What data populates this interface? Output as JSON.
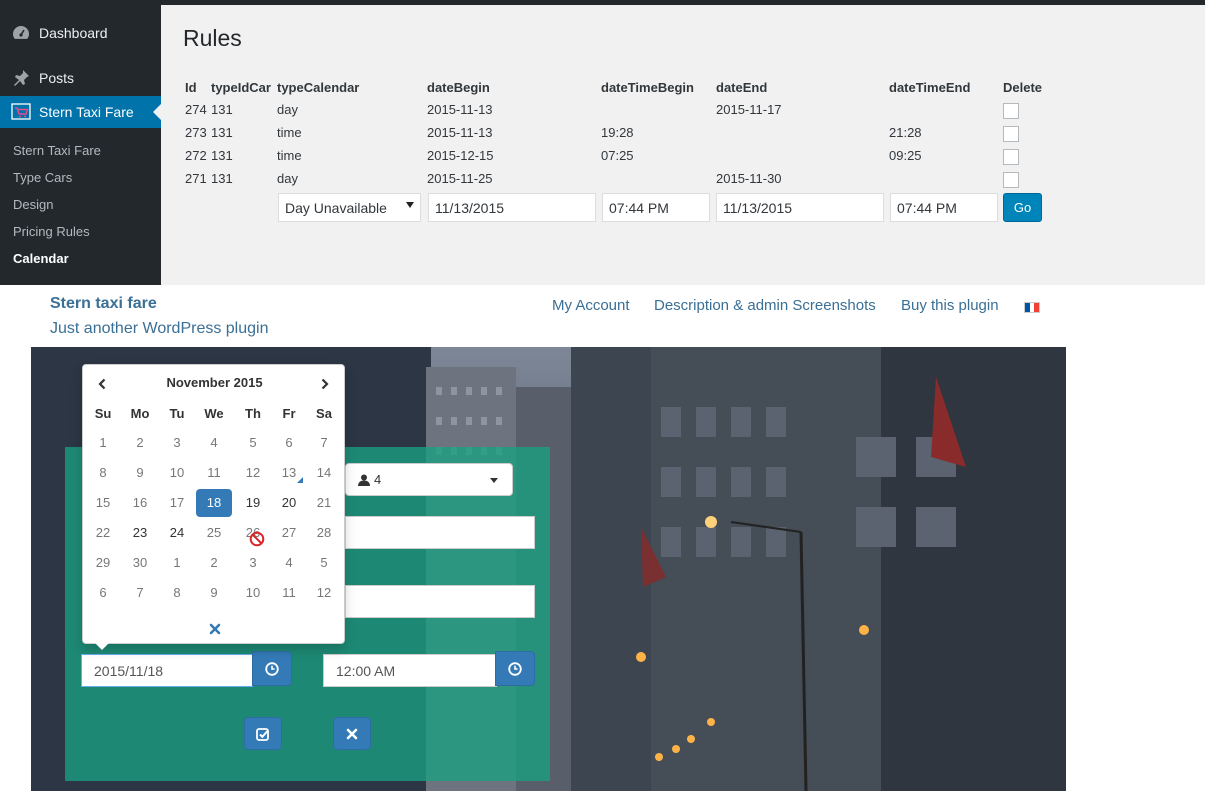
{
  "admin": {
    "sidebar": {
      "top_items": [
        {
          "label": "Dashboard",
          "icon": "dashboard-icon"
        },
        {
          "label": "Posts",
          "icon": "pin-icon"
        },
        {
          "label": "Stern Taxi Fare",
          "icon": "cart-icon"
        }
      ],
      "sub_items": [
        "Stern Taxi Fare",
        "Type Cars",
        "Design",
        "Pricing Rules",
        "Calendar"
      ],
      "current_sub": "Calendar"
    },
    "page_title": "Rules",
    "table": {
      "headers": [
        "Id",
        "typeIdCar",
        "typeCalendar",
        "dateBegin",
        "dateTimeBegin",
        "dateEnd",
        "dateTimeEnd",
        "Delete"
      ],
      "rows": [
        {
          "id": "274",
          "typeIdCar": "131",
          "typeCalendar": "day",
          "dateBegin": "2015-11-13",
          "dateTimeBegin": "",
          "dateEnd": "2015-11-17",
          "dateTimeEnd": ""
        },
        {
          "id": "273",
          "typeIdCar": "131",
          "typeCalendar": "time",
          "dateBegin": "2015-11-13",
          "dateTimeBegin": "19:28",
          "dateEnd": "",
          "dateTimeEnd": "21:28"
        },
        {
          "id": "272",
          "typeIdCar": "131",
          "typeCalendar": "time",
          "dateBegin": "2015-12-15",
          "dateTimeBegin": "07:25",
          "dateEnd": "",
          "dateTimeEnd": "09:25"
        },
        {
          "id": "271",
          "typeIdCar": "131",
          "typeCalendar": "day",
          "dateBegin": "2015-11-25",
          "dateTimeBegin": "",
          "dateEnd": "2015-11-30",
          "dateTimeEnd": ""
        }
      ]
    },
    "form": {
      "type_select": "Day Unavailable",
      "date_begin": "11/13/2015",
      "time_begin": "07:44 PM",
      "date_end": "11/13/2015",
      "time_end": "07:44 PM",
      "go_label": "Go"
    }
  },
  "site": {
    "title": "Stern taxi fare",
    "tagline": "Just another WordPress plugin",
    "nav": [
      "My Account",
      "Description & admin Screenshots",
      "Buy this plugin"
    ],
    "flag_colors": [
      "#0055a4",
      "#ffffff",
      "#ef4135"
    ]
  },
  "booking": {
    "passengers": "4",
    "date_value": "2015/11/18",
    "time_value": "12:00 AM",
    "calendar": {
      "month_label": "November 2015",
      "weekdays": [
        "Su",
        "Mo",
        "Tu",
        "We",
        "Th",
        "Fr",
        "Sa"
      ],
      "weeks": [
        [
          "1",
          "2",
          "3",
          "4",
          "5",
          "6",
          "7"
        ],
        [
          "8",
          "9",
          "10",
          "11",
          "12",
          "13",
          "14"
        ],
        [
          "15",
          "16",
          "17",
          "18",
          "19",
          "20",
          "21"
        ],
        [
          "22",
          "23",
          "24",
          "25",
          "26",
          "27",
          "28"
        ],
        [
          "29",
          "30",
          "1",
          "2",
          "3",
          "4",
          "5"
        ],
        [
          "6",
          "7",
          "8",
          "9",
          "10",
          "11",
          "12"
        ]
      ],
      "selected": "18",
      "today": "13"
    }
  },
  "colors": {
    "wp_blue": "#0073aa",
    "go_blue": "#0085ba",
    "panel_teal": "#1aa082",
    "bootstrap_blue": "#337ab7"
  }
}
